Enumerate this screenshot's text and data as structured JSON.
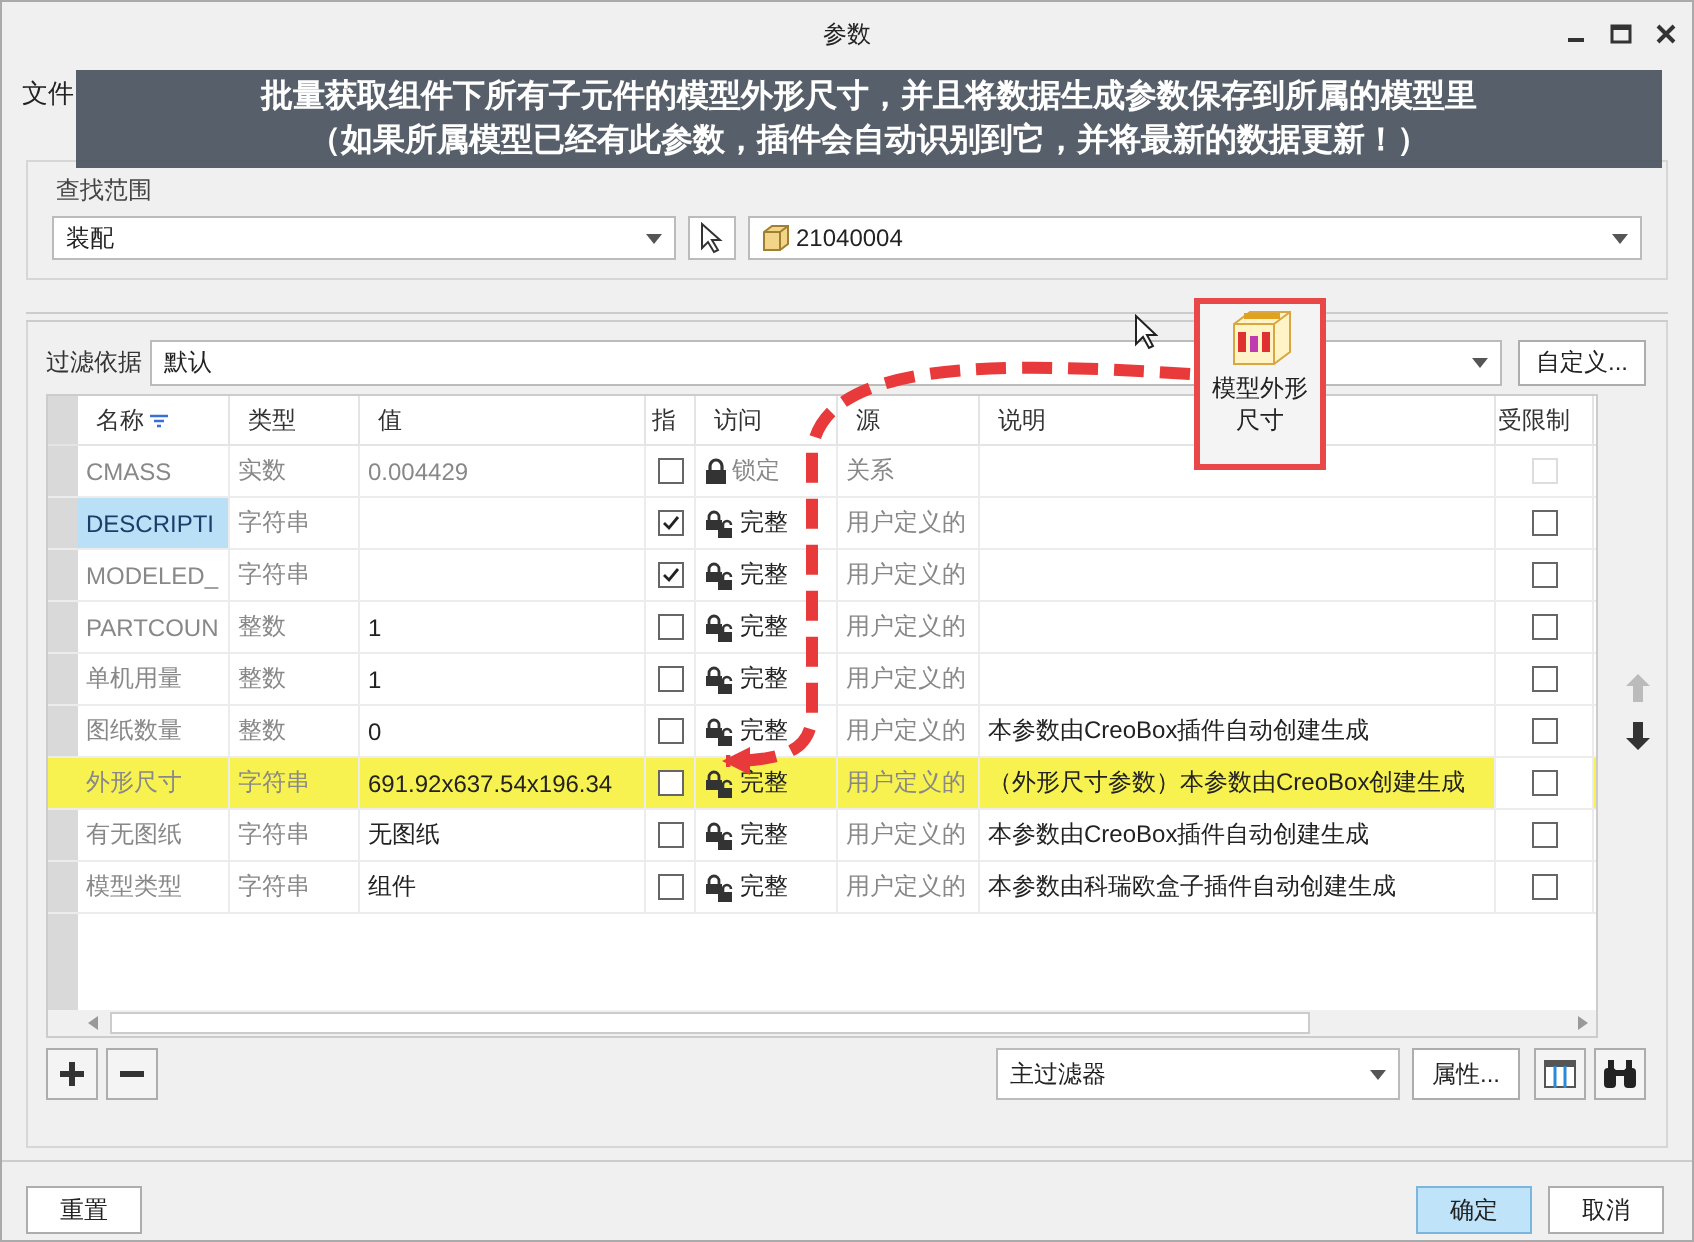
{
  "window": {
    "title": "参数"
  },
  "menu": [
    "文件"
  ],
  "banner": {
    "lines": [
      "批量获取组件下所有子元件的模型外形尺寸，并且将数据生成参数保存到所属的模型里",
      "（如果所属模型已经有此参数，插件会自动识别到它，并将最新的数据更新！）"
    ]
  },
  "search_scope": {
    "label": "查找范围",
    "scope": "装配",
    "model": "21040004"
  },
  "filter": {
    "label": "过滤依据",
    "value": "默认",
    "button": "自定义..."
  },
  "table": {
    "columns": [
      {
        "label": "名称",
        "sorted": true
      },
      {
        "label": "类型",
        "sorted": false
      },
      {
        "label": "值",
        "sorted": false
      },
      {
        "label": "指",
        "sorted": false
      },
      {
        "label": "访问",
        "sorted": false
      },
      {
        "label": "源",
        "sorted": false
      },
      {
        "label": "说明",
        "sorted": false
      },
      {
        "label": "受限制",
        "sorted": false
      }
    ],
    "rows": [
      {
        "name": "CMASS",
        "type": "实数",
        "value": "0.004429",
        "designated": false,
        "access": {
          "kind": "locked",
          "text": "锁定"
        },
        "source": "关系",
        "description": "",
        "restricted": false,
        "disabled": true,
        "selected": false,
        "highlighted": false
      },
      {
        "name": "DESCRIPTI",
        "type": "字符串",
        "value": "",
        "designated": true,
        "access": {
          "kind": "full",
          "text": "完整"
        },
        "source": "用户定义的",
        "description": "",
        "restricted": false,
        "disabled": false,
        "selected": true,
        "highlighted": false
      },
      {
        "name": "MODELED_",
        "type": "字符串",
        "value": "",
        "designated": true,
        "access": {
          "kind": "full",
          "text": "完整"
        },
        "source": "用户定义的",
        "description": "",
        "restricted": false,
        "disabled": false,
        "selected": false,
        "highlighted": false
      },
      {
        "name": "PARTCOUN",
        "type": "整数",
        "value": "1",
        "designated": false,
        "access": {
          "kind": "full",
          "text": "完整"
        },
        "source": "用户定义的",
        "description": "",
        "restricted": false,
        "disabled": false,
        "selected": false,
        "highlighted": false
      },
      {
        "name": "单机用量",
        "type": "整数",
        "value": "1",
        "designated": false,
        "access": {
          "kind": "full",
          "text": "完整"
        },
        "source": "用户定义的",
        "description": "",
        "restricted": false,
        "disabled": false,
        "selected": false,
        "highlighted": false
      },
      {
        "name": "图纸数量",
        "type": "整数",
        "value": "0",
        "designated": false,
        "access": {
          "kind": "full",
          "text": "完整"
        },
        "source": "用户定义的",
        "description": "本参数由CreoBox插件自动创建生成",
        "restricted": false,
        "disabled": false,
        "selected": false,
        "highlighted": false
      },
      {
        "name": "外形尺寸",
        "type": "字符串",
        "value": "691.92x637.54x196.34",
        "designated": false,
        "access": {
          "kind": "full",
          "text": "完整"
        },
        "source": "用户定义的",
        "description": "（外形尺寸参数）本参数由CreoBox创建生成",
        "restricted": false,
        "disabled": false,
        "selected": false,
        "highlighted": true
      },
      {
        "name": "有无图纸",
        "type": "字符串",
        "value": "无图纸",
        "designated": false,
        "access": {
          "kind": "full",
          "text": "完整"
        },
        "source": "用户定义的",
        "description": "本参数由CreoBox插件自动创建生成",
        "restricted": false,
        "disabled": false,
        "selected": false,
        "highlighted": false
      },
      {
        "name": "模型类型",
        "type": "字符串",
        "value": "组件",
        "designated": false,
        "access": {
          "kind": "full",
          "text": "完整"
        },
        "source": "用户定义的",
        "description": "本参数由科瑞欧盒子插件自动创建生成",
        "restricted": false,
        "disabled": false,
        "selected": false,
        "highlighted": false
      }
    ]
  },
  "toolbar": {
    "filter_combo": "主过滤器",
    "properties_button": "属性..."
  },
  "callout": {
    "label": "模型外形尺寸"
  },
  "footer": {
    "reset": "重置",
    "ok": "确定",
    "cancel": "取消"
  }
}
